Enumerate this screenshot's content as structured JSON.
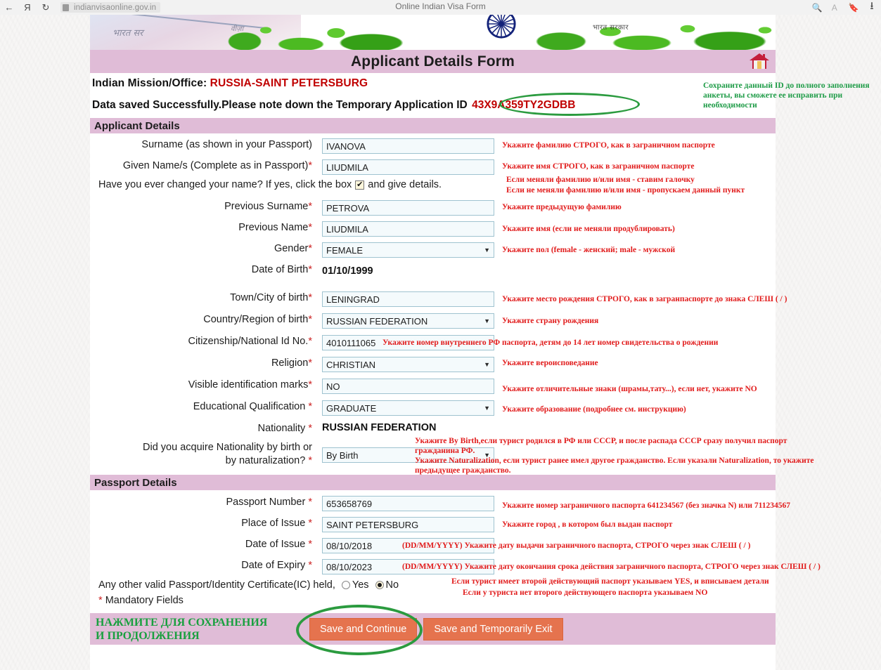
{
  "browser": {
    "back_icon": "back-arrow-icon",
    "forward_icon": "forward-arrow-icon",
    "reload_icon": "reload-icon",
    "lock_icon": "lock-icon",
    "url": "indianvisaonline.gov.in",
    "tab_title": "Online Indian Visa Form",
    "zoom_icon": "zoom-in-icon",
    "read_aloud_icon": "read-aloud-icon",
    "bookmark_icon": "bookmark-icon",
    "download_icon": "download-icon"
  },
  "banner": {
    "hindi_text": "भारत सरकार",
    "chakra_icon": "ashoka-chakra-icon"
  },
  "header": {
    "title": "Applicant Details Form",
    "home_icon": "home-icon",
    "mission_label": "Indian Mission/Office:",
    "mission_value": "RUSSIA-SAINT PETERSBURG",
    "saved_message": "Data saved Successfully.Please note down the Temporary Application ID",
    "temp_application_id": "43X9A359TY2GDBB",
    "green_note": "Сохраните данный ID до полного заполнения анкеты, вы сможете ее исправить при необходимости"
  },
  "sections": {
    "applicant_details": "Applicant Details",
    "passport_details": "Passport Details"
  },
  "fields": {
    "surname": {
      "label": "Surname (as shown in your Passport)",
      "value": "IVANOVA",
      "hint": "Укажите фамилию СТРОГО, как в заграничном паспорте"
    },
    "given_name": {
      "label": "Given Name/s (Complete as in Passport)",
      "required": "*",
      "value": "LIUDMILA",
      "hint": "Укажите имя СТРОГО, как в заграничном паспорте"
    },
    "name_changed": {
      "label_before": "Have you ever changed your name? If yes, click the box",
      "label_after": "and give details.",
      "checked": true,
      "check_glyph": "✔",
      "hint_line1": "Если меняли фамилию и/или имя - ставим галочку",
      "hint_line2": "Если не меняли фамилию и/или имя - пропускаем данный пункт"
    },
    "previous_surname": {
      "label": "Previous Surname",
      "required": "*",
      "value": "PETROVA",
      "hint": "Укажите предыдущую фамилию"
    },
    "previous_name": {
      "label": "Previous Name",
      "required": "*",
      "value": "LIUDMILA",
      "hint": "Укажите имя (если не меняли продублировать)"
    },
    "gender": {
      "label": "Gender",
      "required": "*",
      "value": "FEMALE",
      "hint": "Укажите пол (female - женский; male - мужской"
    },
    "date_of_birth": {
      "label": "Date of Birth",
      "required": "*",
      "value": "01/10/1999"
    },
    "town_of_birth": {
      "label": "Town/City of birth",
      "required": "*",
      "value": "LENINGRAD",
      "hint": "Укажите место рождения СТРОГО, как в загранпаспорте до знака СЛЕШ ( / )"
    },
    "country_of_birth": {
      "label": "Country/Region of birth",
      "required": "*",
      "value": "RUSSIAN FEDERATION",
      "hint": "Укажите страну рождения"
    },
    "national_id": {
      "label": "Citizenship/National Id No.",
      "required": "*",
      "value": "4010111065",
      "hint": "Укажите номер внутреннего РФ паспорта, детям до 14 лет номер свидетельства о рождении"
    },
    "religion": {
      "label": "Religion",
      "required": "*",
      "value": "CHRISTIAN",
      "hint": "Укажите вероисповедание"
    },
    "identification_marks": {
      "label": "Visible identification marks",
      "required": "*",
      "value": "NO",
      "hint": "Укажите отличительные знаки (шрамы,тату...), если нет, укажите NO"
    },
    "education": {
      "label": "Educational Qualification",
      "required": "*",
      "value": "GRADUATE",
      "hint": "Укажите образование (подробнее см. инструкцию)"
    },
    "nationality": {
      "label": "Nationality",
      "required": "*",
      "value": "RUSSIAN FEDERATION"
    },
    "nationality_acquired": {
      "label_line1": "Did you acquire Nationality by birth or",
      "label_line2": "by naturalization?",
      "required": "*",
      "value": "By Birth",
      "hint_line1": "Укажите By Birth,если турист родился в РФ или СССР, и после распада СССР сразу получил паспорт",
      "hint_line2": "гражданина РФ.",
      "hint_line3": "Укажите Naturalization, если турист ранее имел другое гражданство. Если указали Naturalization, то укажите",
      "hint_line4": "предыдущее гражданство."
    },
    "passport_number": {
      "label": "Passport Number",
      "required": "*",
      "value": "653658769",
      "hint": "Укажите номер заграничного паспорта 641234567 (без значка N) или 711234567"
    },
    "place_of_issue": {
      "label": "Place of Issue",
      "required": "*",
      "value": "SAINT PETERSBURG",
      "hint": "Укажите город , в котором был выдан паспорт"
    },
    "date_of_issue": {
      "label": "Date of Issue",
      "required": "*",
      "value": "08/10/2018",
      "hint": "(DD/MM/YYYY) Укажите дату выдачи заграничного паспорта, СТРОГО через знак СЛЕШ ( / )"
    },
    "date_of_expiry": {
      "label": "Date of Expiry",
      "required": "*",
      "value": "08/10/2023",
      "hint": "(DD/MM/YYYY) Укажите дату окончания срока действия заграничного паспорта, СТРОГО через знак СЛЕШ ( / )"
    },
    "other_passport": {
      "label": "Any other valid Passport/Identity Certificate(IC) held,",
      "option_yes": "Yes",
      "option_no": "No",
      "selected": "No",
      "hint_line1": "Если турист имеет второй действующий паспорт указываем YES, и вписываем детали",
      "hint_line2": "Если у туриста нет второго действующего паспорта указываем NO"
    }
  },
  "footer": {
    "mandatory_note": "Mandatory Fields",
    "mandatory_star": "*",
    "green_note_line1": "НАЖМИТЕ ДЛЯ СОХРАНЕНИЯ",
    "green_note_line2": "И ПРОДОЛЖЕНИЯ",
    "save_continue": "Save and Continue",
    "save_temp_exit": "Save and Temporarily Exit"
  },
  "colors": {
    "band": "#e0bcd7",
    "accent_red": "#c00000",
    "hint_red": "#e11b1b",
    "green_highlight": "#2b9b3f",
    "button": "#e5734e"
  }
}
